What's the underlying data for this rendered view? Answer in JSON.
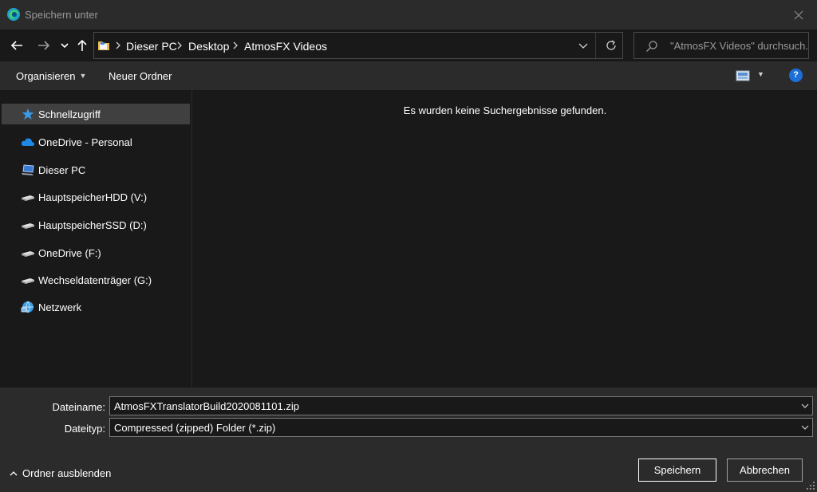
{
  "window": {
    "title": "Speichern unter"
  },
  "address": {
    "crumbs": [
      "Dieser PC",
      "Desktop",
      "AtmosFX Videos"
    ]
  },
  "search": {
    "placeholder": "\"AtmosFX Videos\" durchsuch..."
  },
  "toolbar": {
    "organize_label": "Organisieren",
    "new_folder_label": "Neuer Ordner",
    "help_label": "?"
  },
  "sidebar": {
    "items": [
      {
        "label": "Schnellzugriff",
        "icon": "star-icon"
      },
      {
        "label": "OneDrive - Personal",
        "icon": "cloud-icon"
      },
      {
        "label": "Dieser PC",
        "icon": "computer-icon"
      },
      {
        "label": "HauptspeicherHDD (V:)",
        "icon": "drive-icon"
      },
      {
        "label": "HauptspeicherSSD (D:)",
        "icon": "drive-icon"
      },
      {
        "label": "OneDrive (F:)",
        "icon": "drive-icon"
      },
      {
        "label": "Wechseldatenträger (G:)",
        "icon": "drive-icon"
      },
      {
        "label": "Netzwerk",
        "icon": "network-icon"
      }
    ]
  },
  "content": {
    "empty_message": "Es wurden keine Suchergebnisse gefunden."
  },
  "form": {
    "filename_label": "Dateiname:",
    "filename_value": "AtmosFXTranslatorBuild2020081101.zip",
    "filetype_label": "Dateityp:",
    "filetype_value": "Compressed (zipped) Folder (*.zip)"
  },
  "footer": {
    "hide_folders_label": "Ordner ausblenden",
    "save_label": "Speichern",
    "cancel_label": "Abbrechen"
  },
  "colors": {
    "background": "#191919",
    "panel": "#2b2b2b",
    "accent": "#1b6fd6",
    "selected": "#404040"
  }
}
